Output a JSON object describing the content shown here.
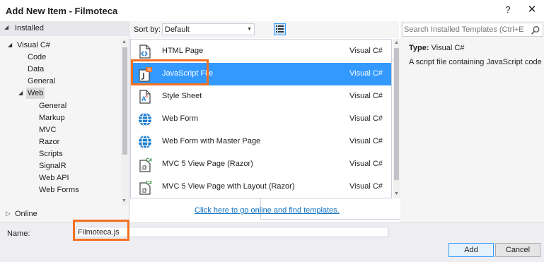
{
  "window": {
    "title": "Add New Item - Filmoteca",
    "help": "?",
    "close": "✕"
  },
  "left": {
    "installed": "Installed",
    "tree": {
      "visual_csharp": "Visual C#",
      "code": "Code",
      "data": "Data",
      "general": "General",
      "web": "Web",
      "web_children": [
        "General",
        "Markup",
        "MVC",
        "Razor",
        "Scripts",
        "SignalR",
        "Web API",
        "Web Forms"
      ]
    },
    "online": "Online"
  },
  "toolbar": {
    "sort_label": "Sort by:",
    "sort_value": "Default"
  },
  "templates": [
    {
      "name": "HTML Page",
      "lang": "Visual C#",
      "icon": "html-page-icon"
    },
    {
      "name": "JavaScript File",
      "lang": "Visual C#",
      "icon": "javascript-file-icon",
      "selected": true
    },
    {
      "name": "Style Sheet",
      "lang": "Visual C#",
      "icon": "style-sheet-icon"
    },
    {
      "name": "Web Form",
      "lang": "Visual C#",
      "icon": "web-globe-icon"
    },
    {
      "name": "Web Form with Master Page",
      "lang": "Visual C#",
      "icon": "web-globe-icon"
    },
    {
      "name": "MVC 5 View Page (Razor)",
      "lang": "Visual C#",
      "icon": "razor-view-icon"
    },
    {
      "name": "MVC 5 View Page with Layout (Razor)",
      "lang": "Visual C#",
      "icon": "razor-view-icon"
    }
  ],
  "online_link": "Click here to go online and find templates.",
  "right": {
    "search_placeholder": "Search Installed Templates (Ctrl+E)",
    "type_label": "Type:",
    "type_value": "Visual C#",
    "description": "A script file containing JavaScript code"
  },
  "bottom": {
    "name_label": "Name:",
    "name_value": "Filmoteca.js",
    "add": "Add",
    "cancel": "Cancel"
  },
  "colors": {
    "selection": "#3399ff",
    "highlight": "#f37021",
    "link": "#0e70c0"
  }
}
